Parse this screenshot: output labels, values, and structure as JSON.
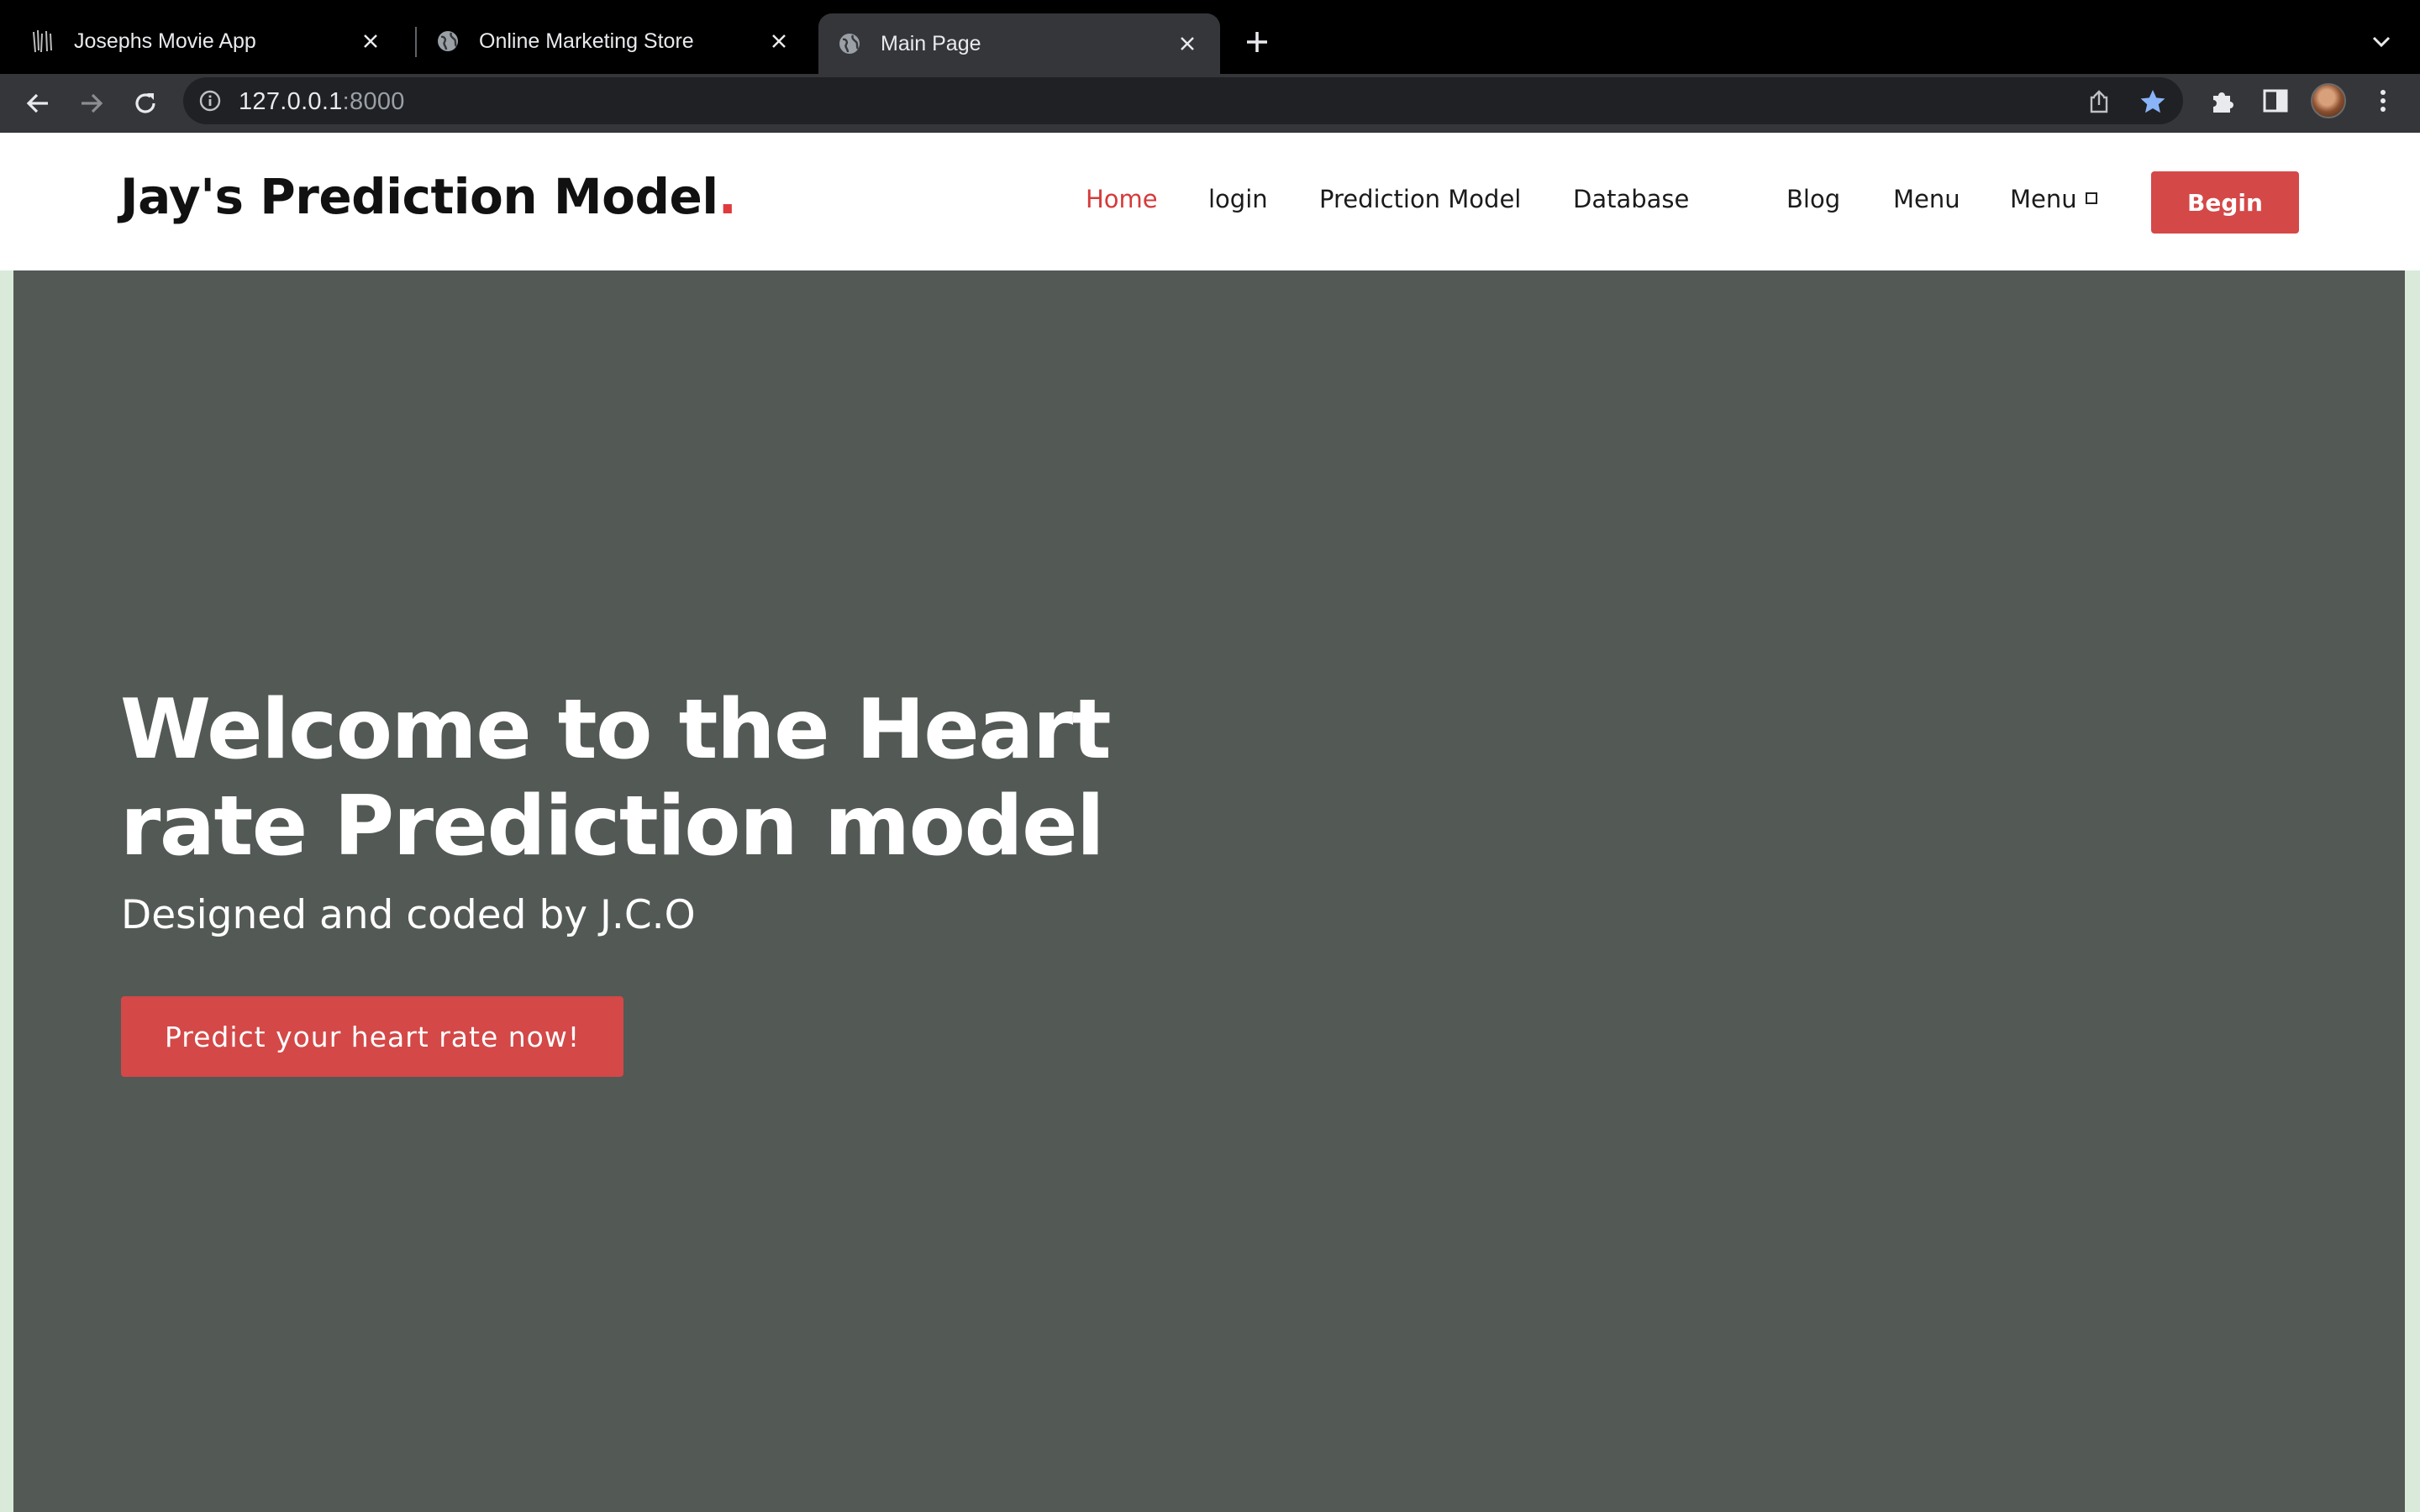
{
  "browser": {
    "tabs": [
      {
        "title": "Josephs Movie App",
        "icon": "movie-favicon"
      },
      {
        "title": "Online Marketing Store",
        "icon": "globe-icon"
      },
      {
        "title": "Main Page",
        "icon": "globe-icon",
        "active": true
      }
    ],
    "url_host": "127.0.0.1",
    "url_port": ":8000"
  },
  "header": {
    "brand": "Jay's Prediction Model",
    "brand_dot": ".",
    "nav": [
      {
        "label": "Home",
        "active": true
      },
      {
        "label": "login"
      },
      {
        "label": "Prediction Model"
      },
      {
        "label": "Database"
      },
      {
        "label": "Blog"
      },
      {
        "label": "Menu"
      },
      {
        "label": "Menu"
      }
    ],
    "begin_label": "Begin"
  },
  "hero": {
    "title": "Welcome to the Heart rate Prediction model",
    "subtitle": "Designed and coded by J.C.O",
    "cta_label": "Predict your heart rate now!"
  },
  "colors": {
    "accent": "#d44848",
    "hero_bg": "#535955",
    "page_edge": "#d9eadb",
    "bookmark_star": "#8ab4f8"
  }
}
